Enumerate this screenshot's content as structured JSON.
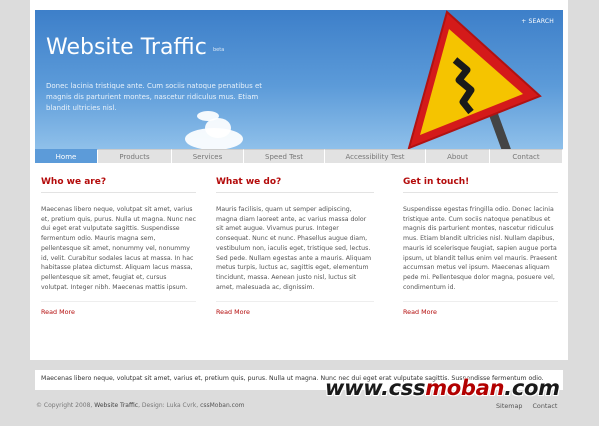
{
  "header": {
    "search_label": "+ SEARCH",
    "title": "Website Traffic",
    "beta": "beta",
    "intro": "Donec lacinia tristique ante. Cum sociis natoque penatibus et magnis dis parturient montes, nascetur ridiculus mus. Etiam blandit ultricies nisl."
  },
  "nav": {
    "tabs": [
      {
        "label": "Home",
        "active": true
      },
      {
        "label": "Products"
      },
      {
        "label": "Services"
      },
      {
        "label": "Speed Test"
      },
      {
        "label": "Accessibility Test"
      },
      {
        "label": "About"
      },
      {
        "label": "Contact"
      }
    ]
  },
  "columns": [
    {
      "title": "Who we are?",
      "body": "Maecenas libero neque, volutpat sit amet, varius et, pretium quis, purus. Nulla ut magna. Nunc nec dui eget erat vulputate sagittis. Suspendisse fermentum odio. Mauris magna sem, pellentesque sit amet, nonummy vel, nonummy id, velit. Curabitur sodales lacus at massa. In hac habitasse platea dictumst. Aliquam lacus massa, pellentesque sit amet, feugiat et, cursus volutpat. Integer nibh. Maecenas mattis ipsum.",
      "more": "Read More"
    },
    {
      "title": "What we do?",
      "body": "Mauris facilisis, quam ut semper adipiscing, magna diam laoreet ante, ac varius massa dolor sit amet augue. Vivamus purus. Integer consequat. Nunc et nunc. Phasellus augue diam, vestibulum non, iaculis eget, tristique sed, lectus. Sed pede. Nullam egestas ante a mauris. Aliquam metus turpis, luctus ac, sagittis eget, elementum tincidunt, massa. Aenean justo nisl, luctus sit amet, malesuada ac, dignissim.",
      "more": "Read More"
    },
    {
      "title": "Get in touch!",
      "body": "Suspendisse egestas fringilla odio. Donec lacinia tristique ante. Cum sociis natoque penatibus et magnis dis parturient montes, nascetur ridiculus mus. Etiam blandit ultricies nisl. Nullam dapibus, mauris id scelerisque feugiat, sapien augue porta ipsum, ut blandit tellus enim vel mauris. Praesent accumsan metus vel ipsum. Maecenas aliquam pede mi. Pellentesque dolor magna, posuere vel, condimentum id.",
      "more": "Read More"
    }
  ],
  "strip": {
    "text": "Maecenas libero neque, volutpat sit amet, varius et, pretium quis, purus. Nulla ut magna. Nunc nec dui eget erat vulputate sagittis. Suspendisse fermentum odio."
  },
  "footer": {
    "copyright": "© Copyright 2008,",
    "site": "Website Traffic",
    "design_prefix": ", Design: Luka Cvrk,",
    "design_link": "cssMoban.com",
    "links": [
      "Sitemap",
      "Contact"
    ]
  },
  "watermark": {
    "prefix": "www.css",
    "highlight": "moban",
    "suffix": ".com"
  },
  "colors": {
    "accent": "#b40c0c",
    "sky": "#5c9bd9",
    "sign_red": "#d41a1a",
    "sign_yellow": "#f5c400"
  }
}
